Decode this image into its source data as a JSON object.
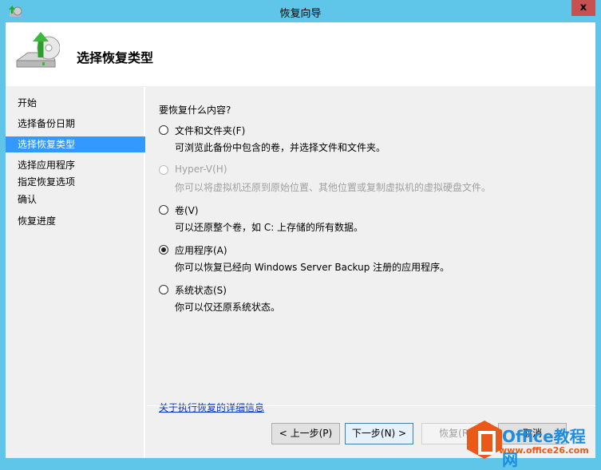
{
  "window": {
    "title": "恢复向导",
    "close_label": "x"
  },
  "header": {
    "title": "选择恢复类型"
  },
  "sidebar": {
    "items": [
      {
        "label": "开始"
      },
      {
        "label": "选择备份日期"
      },
      {
        "label": "选择恢复类型",
        "active": true
      },
      {
        "label": "选择应用程序"
      },
      {
        "label": "指定恢复选项"
      },
      {
        "label": "确认"
      },
      {
        "label": "恢复进度"
      }
    ]
  },
  "main": {
    "question": "要恢复什么内容?",
    "options": [
      {
        "label": "文件和文件夹(F)",
        "desc": "可浏览此备份中包含的卷，并选择文件和文件夹。",
        "selected": false,
        "enabled": true
      },
      {
        "label": "Hyper-V(H)",
        "desc": "你可以将虚拟机还原到原始位置、其他位置或复制虚拟机的虚拟硬盘文件。",
        "selected": false,
        "enabled": false
      },
      {
        "label": "卷(V)",
        "desc": "可以还原整个卷，如 C: 上存储的所有数据。",
        "selected": false,
        "enabled": true
      },
      {
        "label": "应用程序(A)",
        "desc": "你可以恢复已经向 Windows Server Backup 注册的应用程序。",
        "selected": true,
        "enabled": true
      },
      {
        "label": "系统状态(S)",
        "desc": "你可以仅还原系统状态。",
        "selected": false,
        "enabled": true
      }
    ],
    "link": "关于执行恢复的详细信息"
  },
  "buttons": {
    "back": "< 上一步(P)",
    "next": "下一步(N) >",
    "recover": "恢复(R)",
    "cancel": "取消"
  },
  "watermark": {
    "brand": "Office教程网",
    "url": "www.office26.com"
  }
}
